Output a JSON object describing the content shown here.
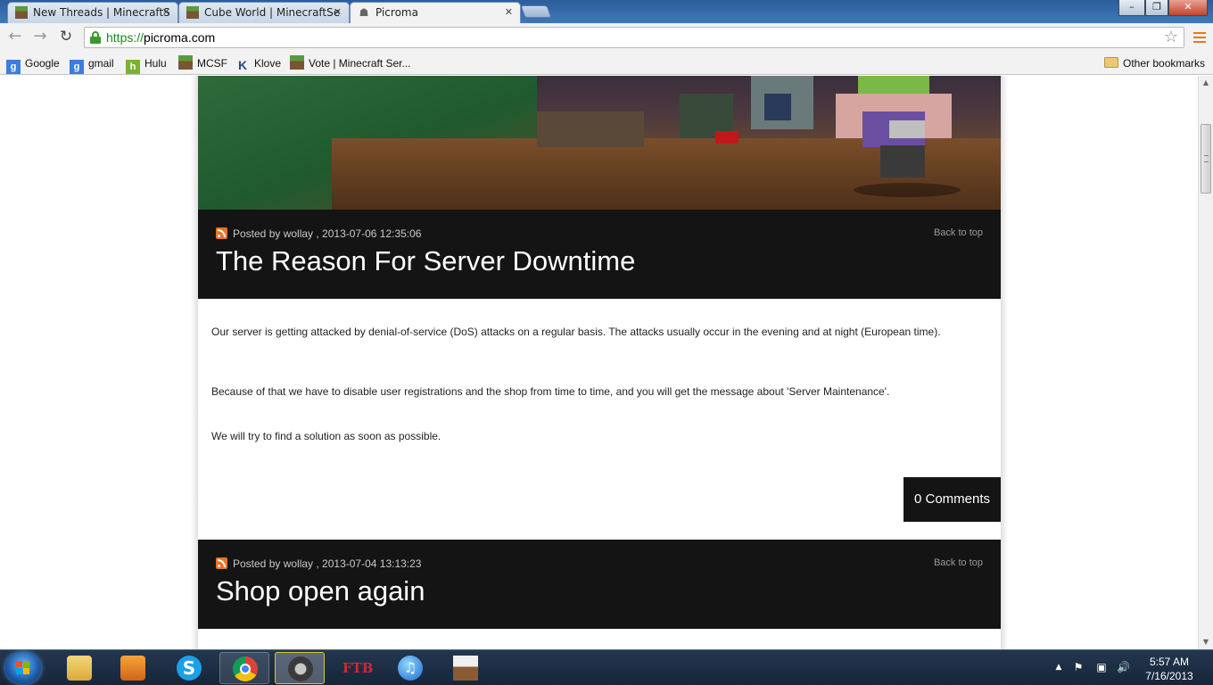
{
  "browser": {
    "tabs": [
      {
        "title": "New Threads | MinecraftS",
        "active": false
      },
      {
        "title": "Cube World | MinecraftSe",
        "active": false
      },
      {
        "title": "Picroma",
        "active": true
      }
    ],
    "tab_close_glyph": "✕",
    "window_controls": {
      "minimize": "–",
      "maximize": "❐",
      "close": "✕"
    },
    "url_scheme": "https://",
    "url_host": "picroma.com",
    "bookmarks": [
      {
        "label": "Google",
        "icon": "google-icon"
      },
      {
        "label": "gmail",
        "icon": "google-icon"
      },
      {
        "label": "Hulu",
        "icon": "hulu-icon"
      },
      {
        "label": "MCSF",
        "icon": "minecraft-block-icon"
      },
      {
        "label": "Klove",
        "icon": "klove-icon"
      },
      {
        "label": "Vote | Minecraft Ser...",
        "icon": "minecraft-block-icon"
      }
    ],
    "other_bookmarks": "Other bookmarks",
    "accent_menu": "#e67a1a"
  },
  "page": {
    "posts": [
      {
        "meta": "Posted by wollay , 2013-07-06 12:35:06",
        "back_to_top": "Back to top",
        "title": "The Reason For Server Downtime",
        "paragraphs": [
          "Our server is getting attacked by denial-of-service (DoS) attacks on a regular basis. The attacks usually occur in the evening and at night (European time).",
          "Because of that we have to disable user registrations and the shop from time to time, and you will get the message about 'Server Maintenance'.",
          "We will try to find a solution as soon as possible."
        ],
        "comments": "0 Comments"
      },
      {
        "meta": "Posted by wollay , 2013-07-04 13:13:23",
        "back_to_top": "Back to top",
        "title": "Shop open again"
      }
    ]
  },
  "taskbar": {
    "apps": [
      {
        "name": "windows-explorer",
        "icon": "folder-icon"
      },
      {
        "name": "media-player",
        "icon": "media-player-icon"
      },
      {
        "name": "skype",
        "icon": "skype-icon"
      },
      {
        "name": "chrome",
        "icon": "chrome-icon"
      },
      {
        "name": "steam",
        "icon": "steam-icon"
      },
      {
        "name": "ftb-launcher",
        "icon": "ftb-icon"
      },
      {
        "name": "itunes",
        "icon": "itunes-icon"
      },
      {
        "name": "minecraft",
        "icon": "minecraft-block-icon"
      }
    ],
    "ftb_label": "FTB",
    "time": "5:57 AM",
    "date": "7/16/2013"
  }
}
